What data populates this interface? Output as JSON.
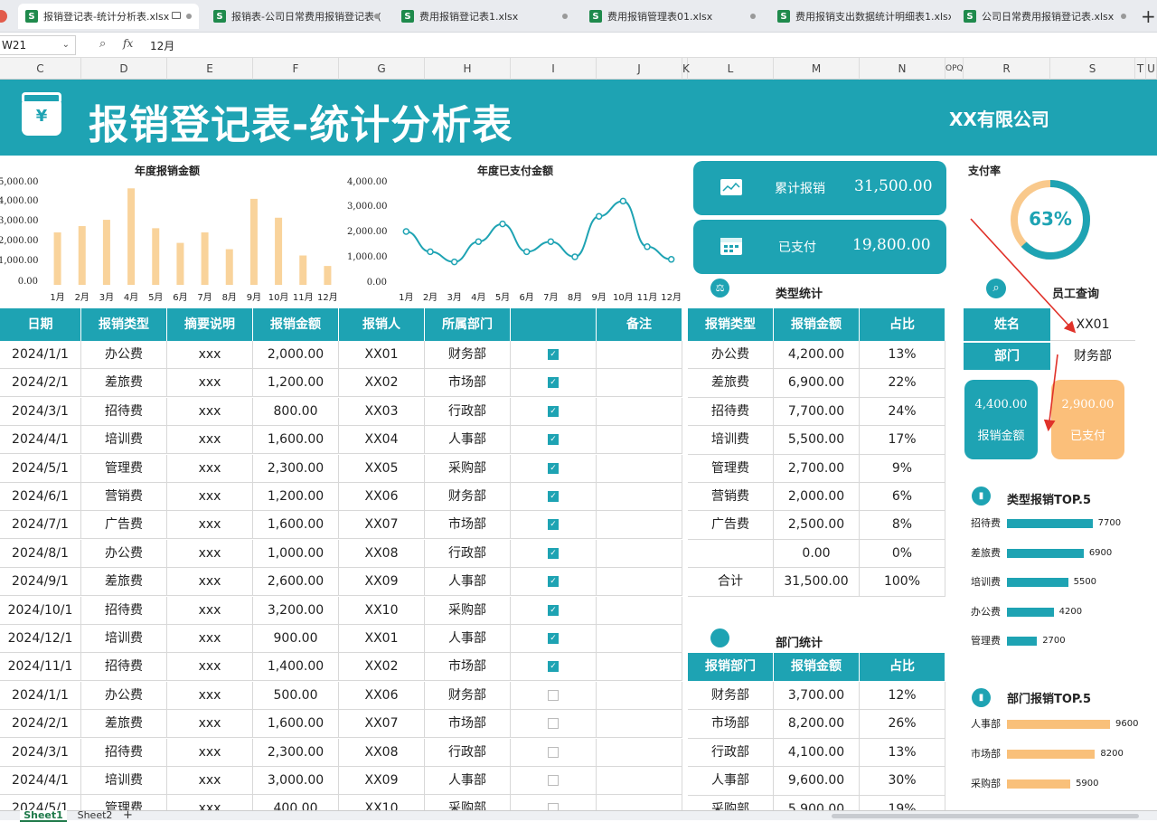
{
  "tabs": [
    {
      "label": "报销登记表-统计分析表.xlsx",
      "active": true
    },
    {
      "label": "报销表-公司日常费用报销登记表 (",
      "active": false
    },
    {
      "label": "费用报销登记表1.xlsx",
      "active": false
    },
    {
      "label": "费用报销管理表01.xlsx",
      "active": false
    },
    {
      "label": "费用报销支出数据统计明细表1.xlsx",
      "active": false
    },
    {
      "label": "公司日常费用报销登记表.xlsx",
      "active": false
    }
  ],
  "formula_bar": {
    "cell_ref": "W21",
    "fx": "fx",
    "value": "12月"
  },
  "columns": [
    "C",
    "D",
    "E",
    "F",
    "G",
    "H",
    "I",
    "J",
    "K",
    "L",
    "M",
    "N",
    "OPQ",
    "R",
    "S",
    "T",
    "U"
  ],
  "banner": {
    "title": "报销登记表-统计分析表",
    "company": "XX有限公司",
    "icon_text": "¥"
  },
  "chart_data": [
    {
      "type": "bar",
      "title": "年度报销金额",
      "categories": [
        "1月",
        "2月",
        "3月",
        "4月",
        "5月",
        "6月",
        "7月",
        "8月",
        "9月",
        "10月",
        "11月",
        "12月"
      ],
      "values": [
        2500,
        2800,
        3100,
        4600,
        2700,
        2000,
        2500,
        1700,
        4100,
        3200,
        1400,
        900
      ],
      "yticks": [
        "0.00",
        "1,000.00",
        "2,000.00",
        "3,000.00",
        "4,000.00",
        "5,000.00"
      ],
      "ylim": [
        0,
        5000
      ],
      "color": "#f9d39b"
    },
    {
      "type": "line",
      "title": "年度已支付金额",
      "categories": [
        "1月",
        "2月",
        "3月",
        "4月",
        "5月",
        "6月",
        "7月",
        "8月",
        "9月",
        "10月",
        "11月",
        "12月"
      ],
      "values": [
        2000,
        1200,
        800,
        1600,
        2300,
        1200,
        1600,
        1000,
        2600,
        3200,
        1400,
        900
      ],
      "yticks": [
        "0.00",
        "1,000.00",
        "2,000.00",
        "3,000.00",
        "4,000.00"
      ],
      "ylim": [
        0,
        4000
      ],
      "color": "#1ea3b3"
    }
  ],
  "summary_cards": [
    {
      "label": "累计报销",
      "value": "31,500.00"
    },
    {
      "label": "已支付",
      "value": "19,800.00"
    }
  ],
  "pay_rate": {
    "title": "支付率",
    "value_text": "63%",
    "fraction": 0.63
  },
  "main_table": {
    "headers": [
      "日期",
      "报销类型",
      "摘要说明",
      "报销金额",
      "报销人",
      "所属部门",
      "",
      "备注"
    ],
    "rows": [
      [
        "2024/1/1",
        "办公费",
        "xxx",
        "2,000.00",
        "XX01",
        "财务部",
        true,
        ""
      ],
      [
        "2024/2/1",
        "差旅费",
        "xxx",
        "1,200.00",
        "XX02",
        "市场部",
        true,
        ""
      ],
      [
        "2024/3/1",
        "招待费",
        "xxx",
        "800.00",
        "XX03",
        "行政部",
        true,
        ""
      ],
      [
        "2024/4/1",
        "培训费",
        "xxx",
        "1,600.00",
        "XX04",
        "人事部",
        true,
        ""
      ],
      [
        "2024/5/1",
        "管理费",
        "xxx",
        "2,300.00",
        "XX05",
        "采购部",
        true,
        ""
      ],
      [
        "2024/6/1",
        "营销费",
        "xxx",
        "1,200.00",
        "XX06",
        "财务部",
        true,
        ""
      ],
      [
        "2024/7/1",
        "广告费",
        "xxx",
        "1,600.00",
        "XX07",
        "市场部",
        true,
        ""
      ],
      [
        "2024/8/1",
        "办公费",
        "xxx",
        "1,000.00",
        "XX08",
        "行政部",
        true,
        ""
      ],
      [
        "2024/9/1",
        "差旅费",
        "xxx",
        "2,600.00",
        "XX09",
        "人事部",
        true,
        ""
      ],
      [
        "2024/10/1",
        "招待费",
        "xxx",
        "3,200.00",
        "XX10",
        "采购部",
        true,
        ""
      ],
      [
        "2024/12/1",
        "培训费",
        "xxx",
        "900.00",
        "XX01",
        "人事部",
        true,
        ""
      ],
      [
        "2024/11/1",
        "招待费",
        "xxx",
        "1,400.00",
        "XX02",
        "市场部",
        true,
        ""
      ],
      [
        "2024/1/1",
        "办公费",
        "xxx",
        "500.00",
        "XX06",
        "财务部",
        false,
        ""
      ],
      [
        "2024/2/1",
        "差旅费",
        "xxx",
        "1,600.00",
        "XX07",
        "市场部",
        false,
        ""
      ],
      [
        "2024/3/1",
        "招待费",
        "xxx",
        "2,300.00",
        "XX08",
        "行政部",
        false,
        ""
      ],
      [
        "2024/4/1",
        "培训费",
        "xxx",
        "3,000.00",
        "XX09",
        "人事部",
        false,
        ""
      ],
      [
        "2024/5/1",
        "管理费",
        "xxx",
        "400.00",
        "XX10",
        "采购部",
        false,
        ""
      ]
    ]
  },
  "type_stats": {
    "title": "类型统计",
    "headers": [
      "报销类型",
      "报销金额",
      "占比"
    ],
    "rows": [
      [
        "办公费",
        "4,200.00",
        "13%"
      ],
      [
        "差旅费",
        "6,900.00",
        "22%"
      ],
      [
        "招待费",
        "7,700.00",
        "24%"
      ],
      [
        "培训费",
        "5,500.00",
        "17%"
      ],
      [
        "管理费",
        "2,700.00",
        "9%"
      ],
      [
        "营销费",
        "2,000.00",
        "6%"
      ],
      [
        "广告费",
        "2,500.00",
        "8%"
      ],
      [
        "",
        "0.00",
        "0%"
      ],
      [
        "合计",
        "31,500.00",
        "100%"
      ]
    ]
  },
  "dept_stats": {
    "title": "部门统计",
    "headers": [
      "报销部门",
      "报销金额",
      "占比"
    ],
    "rows": [
      [
        "财务部",
        "3,700.00",
        "12%"
      ],
      [
        "市场部",
        "8,200.00",
        "26%"
      ],
      [
        "行政部",
        "4,100.00",
        "13%"
      ],
      [
        "人事部",
        "9,600.00",
        "30%"
      ],
      [
        "采购部",
        "5,900.00",
        "19%"
      ]
    ]
  },
  "employee_query": {
    "title": "员工查询",
    "name_label": "姓名",
    "name_value": "XX01",
    "dept_label": "部门",
    "dept_value": "财务部",
    "amount_value": "4,400.00",
    "amount_label": "报销金额",
    "paid_value": "2,900.00",
    "paid_label": "已支付"
  },
  "type_top5": {
    "title": "类型报销TOP.5",
    "items": [
      {
        "label": "招待费",
        "value": 7700
      },
      {
        "label": "差旅费",
        "value": 6900
      },
      {
        "label": "培训费",
        "value": 5500
      },
      {
        "label": "办公费",
        "value": 4200
      },
      {
        "label": "管理费",
        "value": 2700
      }
    ],
    "color": "#1ea3b3"
  },
  "dept_top5": {
    "title": "部门报销TOP.5",
    "items": [
      {
        "label": "人事部",
        "value": 9600
      },
      {
        "label": "市场部",
        "value": 8200
      },
      {
        "label": "采购部",
        "value": 5900
      }
    ],
    "color": "#f9c07a"
  },
  "sheets": [
    "Sheet1",
    "Sheet2"
  ]
}
